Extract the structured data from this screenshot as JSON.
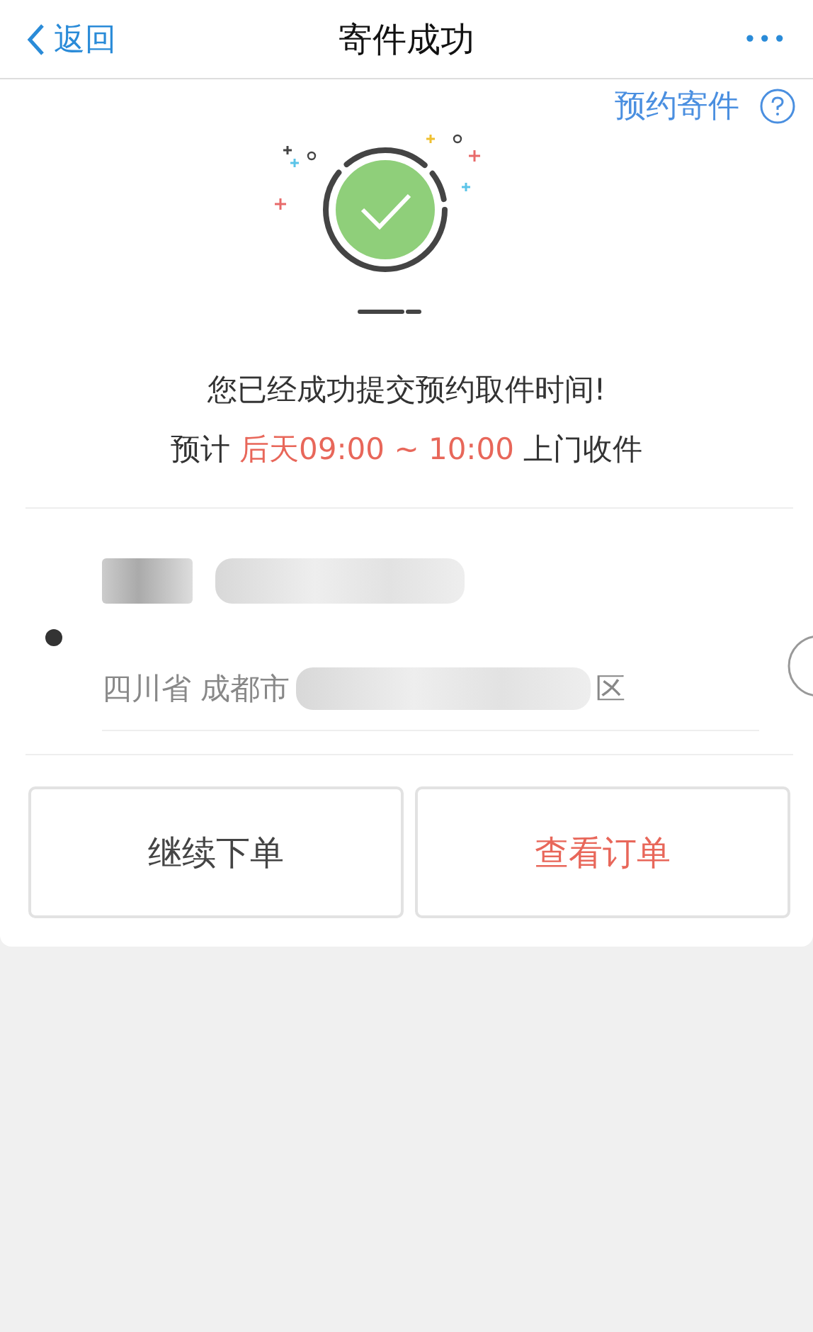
{
  "nav": {
    "back": "返回",
    "title": "寄件成功",
    "more": "•••"
  },
  "help_link": "预约寄件",
  "message": {
    "line1": "您已经成功提交预约取件时间!",
    "prefix": "预计",
    "time": "后天09:00 ~ 10:00",
    "suffix": "上门收件"
  },
  "address": {
    "province": "四川省 成都市",
    "district": "区"
  },
  "buttons": [
    {
      "label": "继续下单",
      "kind": "default"
    },
    {
      "label": "查看订单",
      "kind": "accent"
    }
  ]
}
